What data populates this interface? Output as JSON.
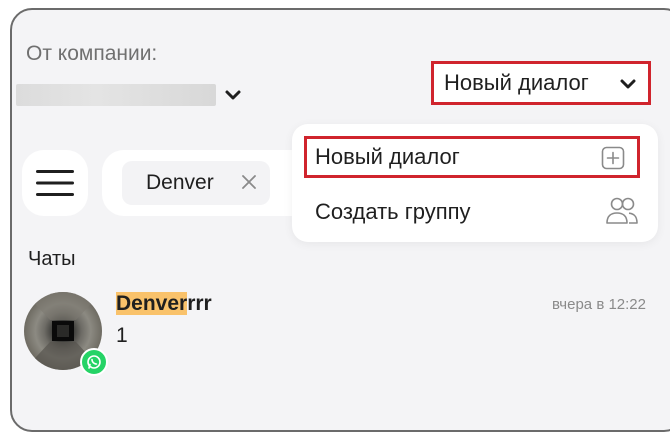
{
  "header": {
    "company_label": "От компании:",
    "select_label": "Новый диалог"
  },
  "search": {
    "chip_text": "Denver"
  },
  "dropdown": {
    "items": [
      {
        "label": "Новый диалог",
        "icon": "plus-square-icon"
      },
      {
        "label": "Создать группу",
        "icon": "people-group-icon"
      }
    ]
  },
  "chats": {
    "heading": "Чаты",
    "items": [
      {
        "name_highlight": "Denver",
        "name_rest": "rrr",
        "time": "вчера в 12:22",
        "preview": "1",
        "channel_icon": "whatsapp-icon"
      }
    ]
  },
  "colors": {
    "highlight_border": "#d0242d",
    "search_highlight": "#f9c26b",
    "whatsapp_green": "#25d366"
  }
}
